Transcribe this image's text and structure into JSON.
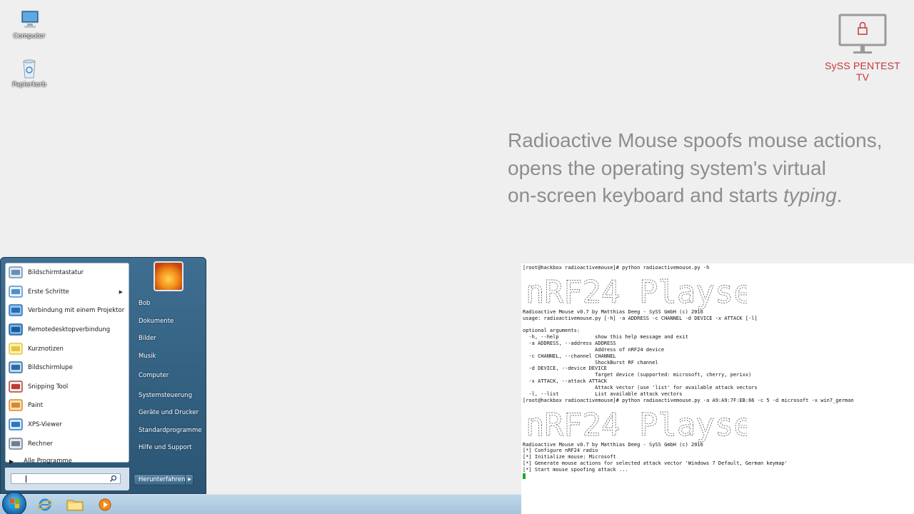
{
  "desktop": {
    "icons": [
      {
        "label": "Computer",
        "icon": "computer-icon"
      },
      {
        "label": "Papierkorb",
        "icon": "recycle-bin-icon"
      }
    ]
  },
  "logo": {
    "caption": "SySS PENTEST TV",
    "color": "#c3393c",
    "icon": "monitor-lock-icon"
  },
  "headline": {
    "line1": "Radioactive Mouse spoofs mouse actions,",
    "line2": "opens the operating system's virtual",
    "line3_normal": "on-screen keyboard and starts ",
    "line3_italic": "typing",
    "line3_end": "."
  },
  "terminal": {
    "lines_a": [
      "[root@hackbox radioactivemouse]# python radioactivemouse.py -h"
    ],
    "banner_text": "nRF24 Playset",
    "lines_b": [
      "Radioactive Mouse v0.7 by Matthias Deeg - SySS GmbH (c) 2016",
      "usage: radioactivemouse.py [-h] -a ADDRESS -c CHANNEL -d DEVICE -x ATTACK [-l]",
      "",
      "optional arguments:",
      "  -h, --help            show this help message and exit",
      "  -a ADDRESS, --address ADDRESS",
      "                        Address of nRF24 device",
      "  -c CHANNEL, --channel CHANNEL",
      "                        ShockBurst RF channel",
      "  -d DEVICE, --device DEVICE",
      "                        Target device (supported: microsoft, cherry, perixx)",
      "  -x ATTACK, --attack ATTACK",
      "                        Attack vector (use 'list' for available attack vectors",
      "  -l, --list            List available attack vectors",
      "[root@hackbox radioactivemouse]# python radioactivemouse.py -a A9:A9:7F:EB:66 -c 5 -d microsoft -x win7_german"
    ],
    "lines_c": [
      "Radioactive Mouse v0.7 by Matthias Deeg - SySS GmbH (c) 2016",
      "[*] Configure nRF24 radio",
      "[*] Initialize mouse: Microsoft",
      "[*] Generate mouse actions for selected attack vector 'Windows 7 Default, German keymap'",
      "[*] Start mouse spoofing attack ..."
    ]
  },
  "start_menu": {
    "programs": [
      {
        "label": "Bildschirmtastatur",
        "icon": "keyboard-icon"
      },
      {
        "label": "Erste Schritte",
        "icon": "getting-started-icon",
        "submenu": true
      },
      {
        "label": "Verbindung mit einem Projektor",
        "icon": "projector-icon"
      },
      {
        "label": "Remotedesktopverbindung",
        "icon": "remote-desktop-icon"
      },
      {
        "label": "Kurznotizen",
        "icon": "sticky-notes-icon"
      },
      {
        "label": "Bildschirmlupe",
        "icon": "magnifier-icon"
      },
      {
        "label": "Snipping Tool",
        "icon": "scissors-icon"
      },
      {
        "label": "Paint",
        "icon": "paint-icon"
      },
      {
        "label": "XPS-Viewer",
        "icon": "xps-viewer-icon"
      },
      {
        "label": "Rechner",
        "icon": "calculator-icon"
      }
    ],
    "all_programs": "Alle Programme",
    "search_placeholder": "",
    "right_items": [
      {
        "label": "Bob"
      },
      {
        "label": "Dokumente"
      },
      {
        "label": "Bilder"
      },
      {
        "label": "Musik"
      },
      {
        "label": "Computer"
      },
      {
        "label": "Systemsteuerung"
      },
      {
        "label": "Geräte und Drucker"
      },
      {
        "label": "Standardprogramme"
      },
      {
        "label": "Hilfe und Support"
      }
    ],
    "shutdown": "Herunterfahren"
  },
  "taskbar": {
    "pinned": [
      {
        "icon": "start-orb-icon"
      },
      {
        "icon": "internet-explorer-icon"
      },
      {
        "icon": "explorer-folder-icon"
      },
      {
        "icon": "media-player-icon"
      }
    ]
  }
}
